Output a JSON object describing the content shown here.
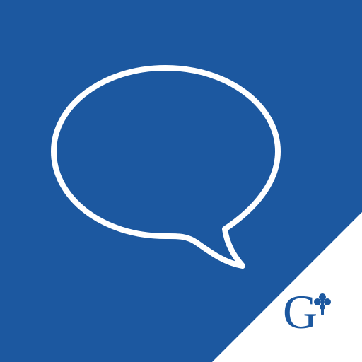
{
  "icon": {
    "name": "speech-bubble-app-icon",
    "background_color": "#1C58A0",
    "corner_color": "#FFFFFF",
    "bubble_stroke_color": "#FFFFFF",
    "logo_color": "#1C58A0",
    "glyphs": [
      "speech-bubble-icon",
      "brand-logo-g-cross"
    ],
    "logo_letter": "G"
  }
}
